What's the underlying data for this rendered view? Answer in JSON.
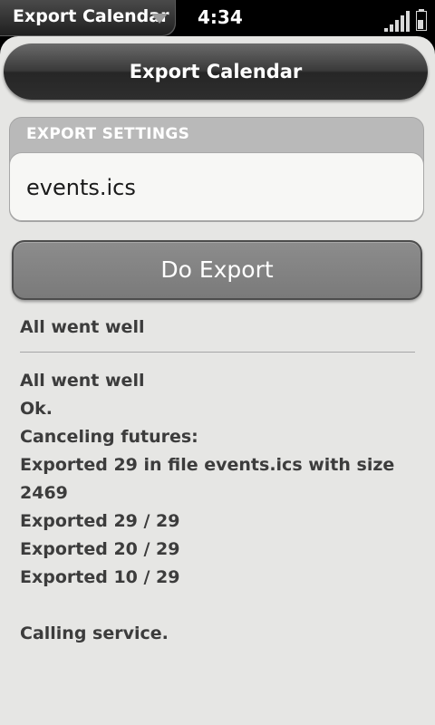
{
  "status_bar": {
    "app_menu_title": "Export Calendar",
    "time": "4:34",
    "signal_bars": 5,
    "battery_level": 0.6
  },
  "header": {
    "title": "Export Calendar"
  },
  "export_settings": {
    "label": "EXPORT SETTINGS",
    "filename": "events.ics"
  },
  "actions": {
    "do_export_label": "Do Export"
  },
  "status": {
    "message": "All went well"
  },
  "log": {
    "lines": [
      "All went well",
      "Ok.",
      "Canceling futures:",
      "Exported 29 in file events.ics with size",
      "2469",
      "Exported 29 / 29",
      "Exported 20 / 29",
      "Exported 10 / 29",
      "",
      "Calling service."
    ]
  },
  "colors": {
    "background": "#e6e6e4",
    "header": "#2e2e2e",
    "button": "#808080",
    "text": "#3c3c3c"
  }
}
